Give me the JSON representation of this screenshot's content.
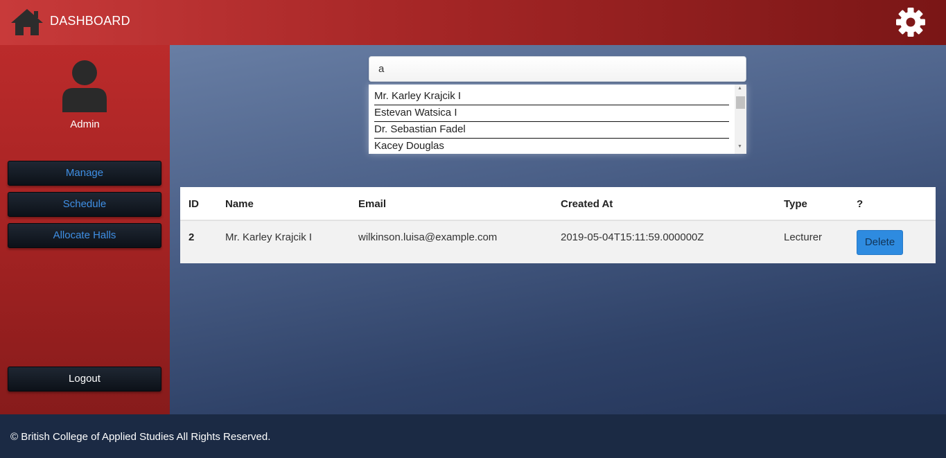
{
  "header": {
    "title": "DASHBOARD",
    "home_icon": "home-icon",
    "settings_icon": "gear-icon"
  },
  "sidebar": {
    "user_label": "Admin",
    "avatar_icon": "user-avatar-icon",
    "nav": {
      "manage": "Manage",
      "schedule": "Schedule",
      "allocate_halls": "Allocate Halls"
    },
    "logout": "Logout"
  },
  "search": {
    "value": "a",
    "suggestions": [
      "Mr. Karley Krajcik I",
      "Estevan Watsica I",
      "Dr. Sebastian Fadel",
      "Kacey Douglas"
    ]
  },
  "table": {
    "headers": {
      "id": "ID",
      "name": "Name",
      "email": "Email",
      "created_at": "Created At",
      "type": "Type",
      "action": "?"
    },
    "rows": [
      {
        "id": "2",
        "name": "Mr. Karley Krajcik I",
        "email": "wilkinson.luisa@example.com",
        "created_at": "2019-05-04T15:11:59.000000Z",
        "type": "Lecturer",
        "action": "Delete"
      }
    ]
  },
  "footer": {
    "copyright": "© British College of Applied Studies All Rights Reserved."
  },
  "colors": {
    "header_red": "#c83a3a",
    "sidebar_red": "#a52323",
    "button_blue": "#2e8be0",
    "nav_link_blue": "#3f8fe4",
    "footer_navy": "#1b2a44"
  }
}
